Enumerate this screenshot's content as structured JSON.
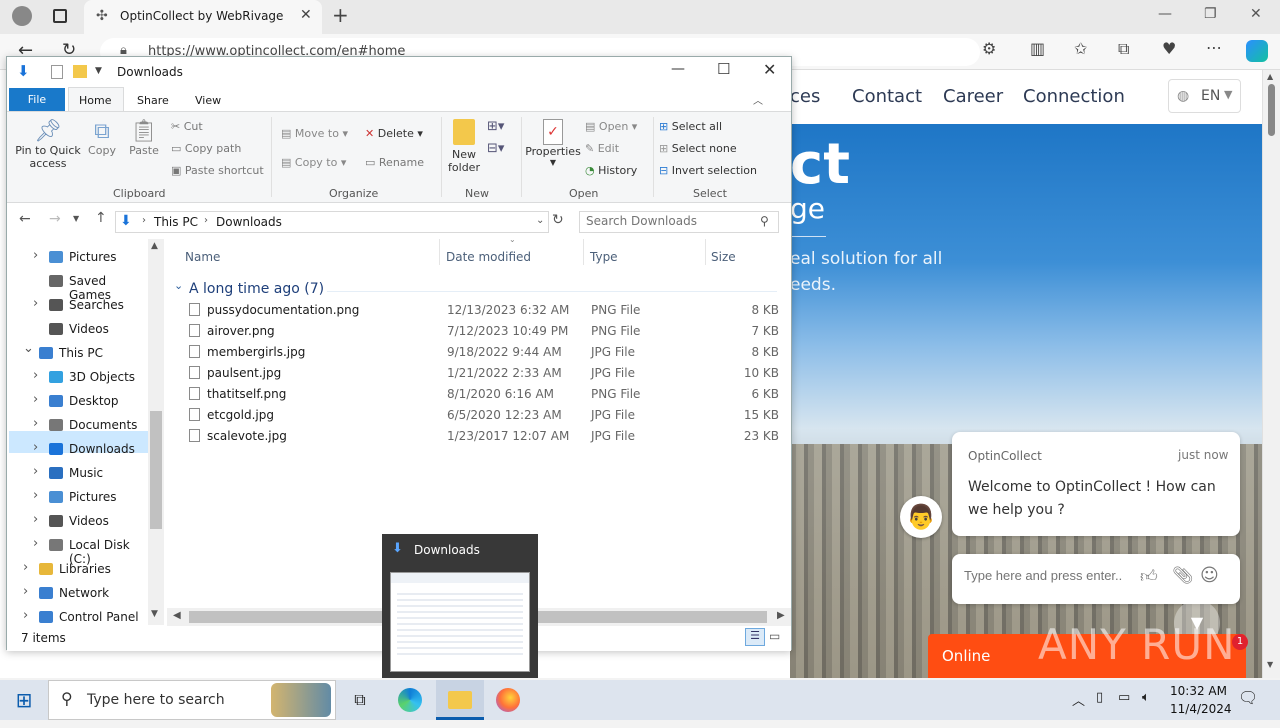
{
  "browser": {
    "tab_title": "OptinCollect by WebRivage",
    "url": "https://www.optincollect.com/en#home"
  },
  "website": {
    "nav": [
      "ces",
      "Contact",
      "Career",
      "Connection"
    ],
    "language": "EN",
    "hero_big": "ct",
    "hero_sub": "ge",
    "hero_text1": "eal solution for all",
    "hero_text2": "eeds.",
    "chat": {
      "sender": "OptinCollect",
      "time": "just now",
      "message": "Welcome to OptinCollect ! How can we help you ?",
      "input_placeholder": "Type here and press enter..",
      "status": "Online",
      "badge": "1"
    },
    "watermark": "ANY RUN"
  },
  "explorer": {
    "title": "Downloads",
    "tabs": [
      "File",
      "Home",
      "Share",
      "View"
    ],
    "ribbon": {
      "pin": "Pin to Quick access",
      "copy": "Copy",
      "paste": "Paste",
      "cut": "Cut",
      "copy_path": "Copy path",
      "paste_shortcut": "Paste shortcut",
      "move_to": "Move to",
      "copy_to": "Copy to",
      "delete": "Delete",
      "rename": "Rename",
      "new_folder": "New folder",
      "properties": "Properties",
      "open": "Open",
      "edit": "Edit",
      "history": "History",
      "select_all": "Select all",
      "select_none": "Select none",
      "invert_selection": "Invert selection",
      "groups": [
        "Clipboard",
        "Organize",
        "New",
        "Open",
        "Select"
      ]
    },
    "breadcrumb": [
      "This PC",
      "Downloads"
    ],
    "search_placeholder": "Search Downloads",
    "tree": [
      {
        "label": "Pictures",
        "indent": 1,
        "exp": true
      },
      {
        "label": "Saved Games",
        "indent": 1,
        "exp": false
      },
      {
        "label": "Searches",
        "indent": 1,
        "exp": true
      },
      {
        "label": "Videos",
        "indent": 1,
        "exp": false
      },
      {
        "label": "This PC",
        "indent": 0,
        "exp": true
      },
      {
        "label": "3D Objects",
        "indent": 1,
        "exp": true
      },
      {
        "label": "Desktop",
        "indent": 1,
        "exp": true
      },
      {
        "label": "Documents",
        "indent": 1,
        "exp": true
      },
      {
        "label": "Downloads",
        "indent": 1,
        "exp": true
      },
      {
        "label": "Music",
        "indent": 1,
        "exp": true
      },
      {
        "label": "Pictures",
        "indent": 1,
        "exp": true
      },
      {
        "label": "Videos",
        "indent": 1,
        "exp": true
      },
      {
        "label": "Local Disk (C:)",
        "indent": 1,
        "exp": true
      },
      {
        "label": "Libraries",
        "indent": 0,
        "exp": true
      },
      {
        "label": "Network",
        "indent": 0,
        "exp": true
      },
      {
        "label": "Control Panel",
        "indent": 0,
        "exp": true
      }
    ],
    "columns": [
      "Name",
      "Date modified",
      "Type",
      "Size"
    ],
    "group_header": "A long time ago (7)",
    "files": [
      {
        "name": "pussydocumentation.png",
        "date": "12/13/2023 6:32 AM",
        "type": "PNG File",
        "size": "8 KB"
      },
      {
        "name": "airover.png",
        "date": "7/12/2023 10:49 PM",
        "type": "PNG File",
        "size": "7 KB"
      },
      {
        "name": "membergirls.jpg",
        "date": "9/18/2022 9:44 AM",
        "type": "JPG File",
        "size": "8 KB"
      },
      {
        "name": "paulsent.jpg",
        "date": "1/21/2022 2:33 AM",
        "type": "JPG File",
        "size": "10 KB"
      },
      {
        "name": "thatitself.png",
        "date": "8/1/2020 6:16 AM",
        "type": "PNG File",
        "size": "6 KB"
      },
      {
        "name": "etcgold.jpg",
        "date": "6/5/2020 12:23 AM",
        "type": "JPG File",
        "size": "15 KB"
      },
      {
        "name": "scalevote.jpg",
        "date": "1/23/2017 12:07 AM",
        "type": "JPG File",
        "size": "23 KB"
      }
    ],
    "status": "7 items"
  },
  "thumbnail": {
    "title": "Downloads"
  },
  "taskbar": {
    "search_placeholder": "Type here to search",
    "time": "10:32 AM",
    "date": "11/4/2024"
  }
}
